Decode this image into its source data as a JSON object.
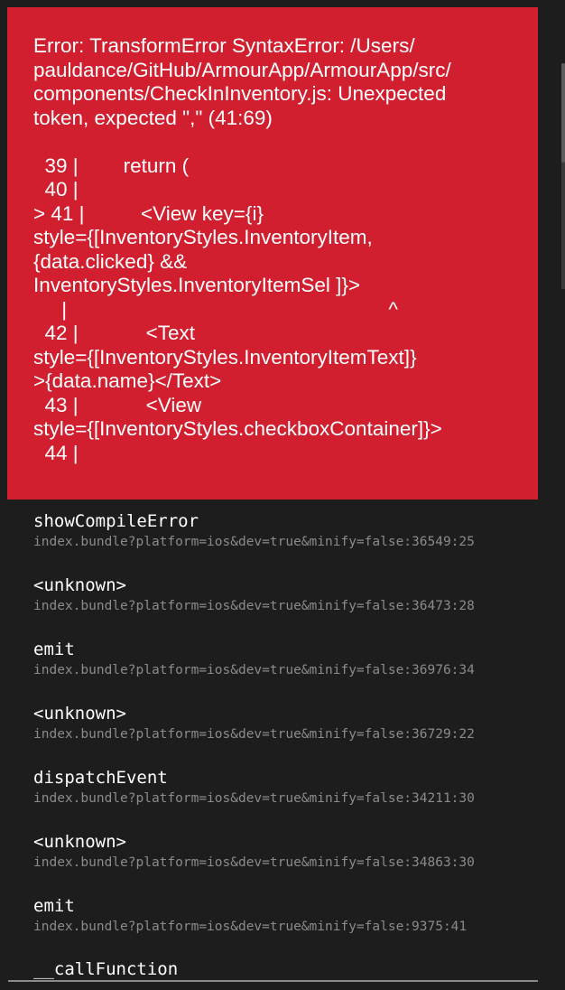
{
  "error": {
    "message": "Error: TransformError SyntaxError: /Users/\npauldance/GitHub/ArmourApp/ArmourApp/src/\ncomponents/CheckInInventory.js: Unexpected\ntoken, expected \",\" (41:69)\n\n  39 |        return (\n  40 |\n> 41 |          <View key={i}\nstyle={[InventoryStyles.InventoryItem,\n{data.clicked} &&\nInventoryStyles.InventoryItemSel ]}>\n     |                                                         ^\n  42 |            <Text\nstyle={[InventoryStyles.InventoryItemText]}\n>{data.name}</Text>\n  43 |            <View\nstyle={[InventoryStyles.checkboxContainer]}>\n  44 |"
  },
  "stack": {
    "frames": [
      {
        "method": "showCompileError",
        "location": "index.bundle?platform=ios&dev=true&minify=false:36549:25"
      },
      {
        "method": "<unknown>",
        "location": "index.bundle?platform=ios&dev=true&minify=false:36473:28"
      },
      {
        "method": "emit",
        "location": "index.bundle?platform=ios&dev=true&minify=false:36976:34"
      },
      {
        "method": "<unknown>",
        "location": "index.bundle?platform=ios&dev=true&minify=false:36729:22"
      },
      {
        "method": "dispatchEvent",
        "location": "index.bundle?platform=ios&dev=true&minify=false:34211:30"
      },
      {
        "method": "<unknown>",
        "location": "index.bundle?platform=ios&dev=true&minify=false:34863:30"
      },
      {
        "method": "emit",
        "location": "index.bundle?platform=ios&dev=true&minify=false:9375:41"
      }
    ],
    "last_method": "__callFunction"
  },
  "colors": {
    "error_background": "#d11f2f",
    "screen_background": "#1d1d1d",
    "method_text": "#ffffff",
    "location_text": "#8b8b8b"
  }
}
